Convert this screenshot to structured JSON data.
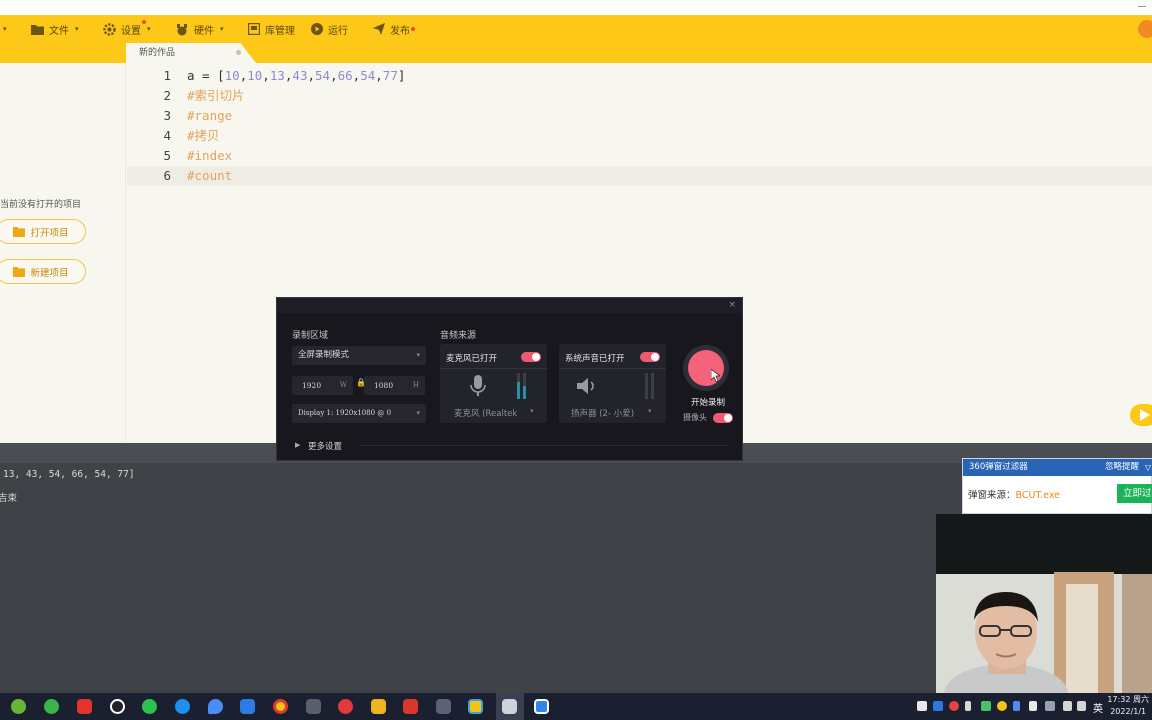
{
  "toolbar": {
    "items": [
      {
        "label": "文件",
        "icon": "folder-icon"
      },
      {
        "label": "设置",
        "icon": "gear-icon"
      },
      {
        "label": "硬件",
        "icon": "hardware-icon"
      },
      {
        "label": "库管理",
        "icon": "library-icon"
      },
      {
        "label": "运行",
        "icon": "play-icon"
      },
      {
        "label": "发布",
        "icon": "send-icon"
      }
    ]
  },
  "tab": {
    "title": "新的作品"
  },
  "sidebar": {
    "no_project_text": "当前没有打开的项目",
    "open_project": "打开项目",
    "new_project": "新建项目"
  },
  "editor": {
    "lines": [
      {
        "num": "1",
        "kind": "code"
      },
      {
        "num": "2",
        "text": "#索引切片"
      },
      {
        "num": "3",
        "text": "#range"
      },
      {
        "num": "4",
        "text": "#拷贝"
      },
      {
        "num": "5",
        "text": "#index"
      },
      {
        "num": "6",
        "text": "#count"
      }
    ],
    "line1": {
      "prefix": "a = [",
      "numbers": [
        "10",
        "10",
        "13",
        "43",
        "54",
        "66",
        "54",
        "77"
      ],
      "suffix": "]"
    }
  },
  "console": {
    "lines": [
      "13, 43, 54, 66, 54, 77]",
      "吉束"
    ]
  },
  "recorder": {
    "area_label": "录制区域",
    "mode": "全屏录制模式",
    "width": "1920",
    "width_unit": "W",
    "height": "1080",
    "height_unit": "H",
    "display": "Display 1: 1920x1080 @ 0",
    "audio_label": "音频来源",
    "mic_title": "麦克风已打开",
    "mic_device": "麦克风 (Realtek",
    "sys_title": "系统声音已打开",
    "sys_device": "扬声器 (2- 小爱)",
    "start_label": "开始录制",
    "camera_label": "摄像头",
    "more_settings": "更多设置",
    "accent_color": "#f4637a"
  },
  "popup": {
    "title": "360弹窗过滤器",
    "ignore": "忽略提醒",
    "source_label": "弹窗来源：",
    "source_value": "BCUT.exe",
    "button": "立即过"
  },
  "taskbar": {
    "ime": "英",
    "time": "17:32 周六",
    "date": "2022/1/1"
  }
}
